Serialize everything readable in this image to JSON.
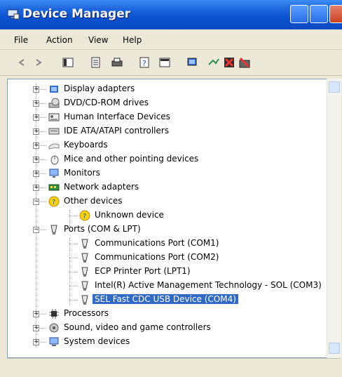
{
  "window": {
    "title": "Device Manager"
  },
  "menu": [
    "File",
    "Action",
    "View",
    "Help"
  ],
  "toolbar": [
    "back-icon",
    "forward-icon",
    "show-hide-console-tree-icon",
    "properties-icon",
    "print-icon",
    "help-icon",
    "view-icon",
    "scan-hardware-icon",
    "update-driver-icon",
    "uninstall-icon",
    "disable-icon"
  ],
  "tree": {
    "items": [
      {
        "label": "Display adapters",
        "icon": "display-adapter-icon",
        "toggle": "+"
      },
      {
        "label": "DVD/CD-ROM drives",
        "icon": "dvd-drive-icon",
        "toggle": "+"
      },
      {
        "label": "Human Interface Devices",
        "icon": "hid-icon",
        "toggle": "+"
      },
      {
        "label": "IDE ATA/ATAPI controllers",
        "icon": "ide-controller-icon",
        "toggle": "+"
      },
      {
        "label": "Keyboards",
        "icon": "keyboard-icon",
        "toggle": "+"
      },
      {
        "label": "Mice and other pointing devices",
        "icon": "mouse-icon",
        "toggle": "+"
      },
      {
        "label": "Monitors",
        "icon": "monitor-icon",
        "toggle": "+"
      },
      {
        "label": "Network adapters",
        "icon": "network-adapter-icon",
        "toggle": "+"
      },
      {
        "label": "Other devices",
        "icon": "unknown-device-icon",
        "toggle": "-"
      },
      {
        "label": "Unknown device",
        "icon": "unknown-device-icon",
        "child": true
      },
      {
        "label": "Ports (COM & LPT)",
        "icon": "port-icon",
        "toggle": "-"
      },
      {
        "label": "Communications Port (COM1)",
        "icon": "port-icon",
        "child": true
      },
      {
        "label": "Communications Port (COM2)",
        "icon": "port-icon",
        "child": true
      },
      {
        "label": "ECP Printer Port (LPT1)",
        "icon": "port-icon",
        "child": true
      },
      {
        "label": "Intel(R) Active Management Technology - SOL (COM3)",
        "icon": "port-icon",
        "child": true
      },
      {
        "label": "SEL Fast CDC USB Device (COM4)",
        "icon": "port-icon",
        "child": true,
        "selected": true
      },
      {
        "label": "Processors",
        "icon": "processor-icon",
        "toggle": "+"
      },
      {
        "label": "Sound, video and game controllers",
        "icon": "sound-icon",
        "toggle": "+"
      },
      {
        "label": "System devices",
        "icon": "system-devices-icon",
        "toggle": "+"
      }
    ]
  }
}
